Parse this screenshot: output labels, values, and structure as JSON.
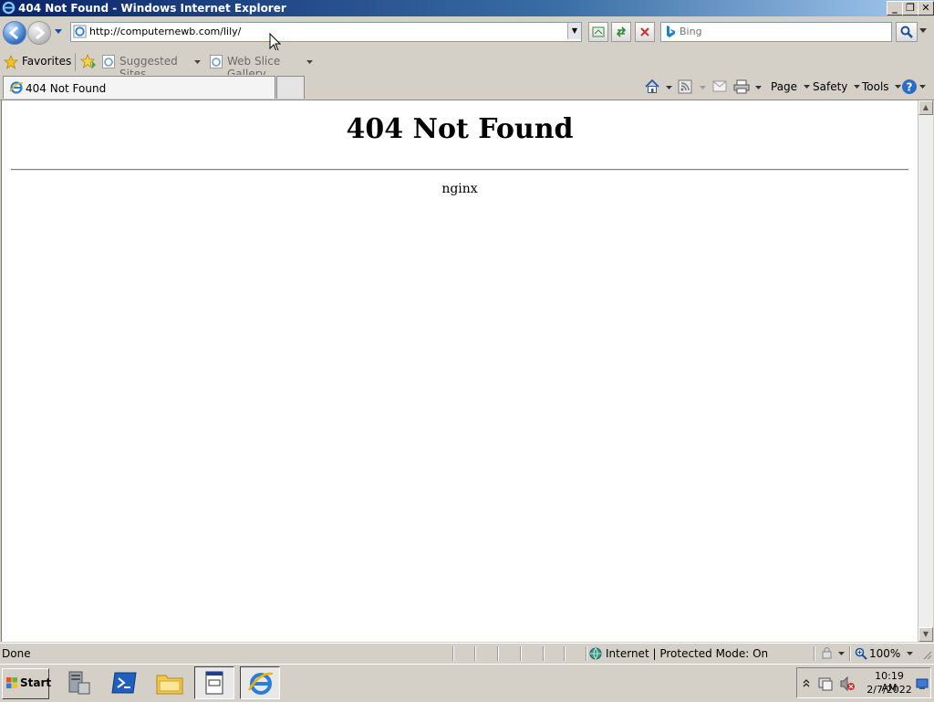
{
  "window": {
    "title": "404 Not Found - Windows Internet Explorer",
    "minimize": "_",
    "restore": "❐",
    "close": "✕"
  },
  "nav": {
    "address": "http://computernewb.com/lily/",
    "search_placeholder": "Bing"
  },
  "favorites_bar": {
    "favorites_label": "Favorites",
    "items": [
      "Suggested Sites",
      "Web Slice Gallery"
    ]
  },
  "tabs": [
    {
      "label": "404 Not Found"
    }
  ],
  "commandbar": {
    "page": "Page",
    "safety": "Safety",
    "tools": "Tools"
  },
  "page": {
    "heading": "404 Not Found",
    "server": "nginx"
  },
  "statusbar": {
    "status": "Done",
    "zone": "Internet | Protected Mode: On",
    "zoom": "100%"
  },
  "taskbar": {
    "start": "Start",
    "time": "10:19 AM",
    "date": "2/7/2022"
  },
  "colors": {
    "titlebar": "#0a246a",
    "chrome": "#d4d0c8",
    "content_bg": "#ffffff"
  }
}
